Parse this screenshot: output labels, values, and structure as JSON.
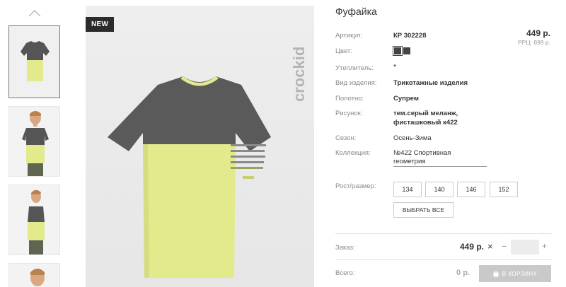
{
  "product": {
    "title": "Фуфайка",
    "badge": "NEW",
    "brand_watermark": "crockid",
    "price": "449 р.",
    "rrp": "РРЦ: 899 р."
  },
  "gallery": {
    "up_icon": "chevron-up-icon",
    "thumbnails": [
      "thumbnail-tshirt-front",
      "thumbnail-boy-front",
      "thumbnail-boy-side",
      "thumbnail-boy-portrait"
    ],
    "active_index": 0
  },
  "specs": {
    "article_label": "Артикул:",
    "article_value": "КР 302228",
    "color_label": "Цвет:",
    "swatch_colors": [
      "#444444",
      "#444444"
    ],
    "insulation_label": "Утеплитель:",
    "insulation_value": "\"",
    "type_label": "Вид изделия:",
    "type_value": "Трикотажные изделия",
    "fabric_label": "Полотно:",
    "fabric_value": "Супрем",
    "pattern_label": "Рисунок:",
    "pattern_value_1": "тем.серый меланж,",
    "pattern_value_2": "фисташковый к422",
    "season_label": "Сезон:",
    "season_value": "Осень-Зима",
    "collection_label": "Коллекция:",
    "collection_value_1": "№422 Спортивная",
    "collection_value_2": "геометрия"
  },
  "sizes": {
    "label": "Рост/размер:",
    "options": [
      "134",
      "140",
      "146",
      "152"
    ],
    "choose_all": "ВЫБРАТЬ ВСЕ"
  },
  "order": {
    "label": "Заказ:",
    "price": "449 р.",
    "remove_symbol": "×",
    "minus_symbol": "−",
    "plus_symbol": "+",
    "total_label": "Всего:",
    "total_value": "0 р.",
    "cart_button": "В КОРЗИНУ",
    "cart_icon": "bag-icon"
  },
  "colors": {
    "tshirt_yellow": "#e3ea8c",
    "tshirt_gray": "#555555",
    "badge_bg": "#2b2b2b",
    "cart_bg": "#c9c9c9"
  }
}
